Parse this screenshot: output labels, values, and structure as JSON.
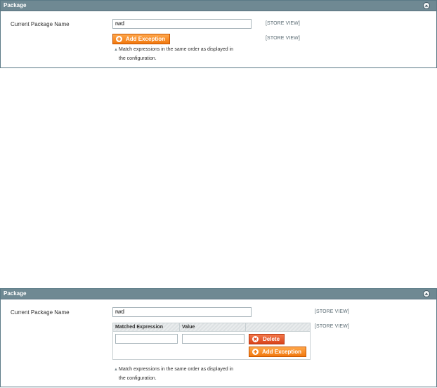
{
  "panels": [
    {
      "title": "Package",
      "field_label": "Current Package Name",
      "field_value": "rwd",
      "scope_field": "[STORE VIEW]",
      "scope_exceptions": "[STORE VIEW]",
      "add_exception_label": "Add Exception",
      "note_line1": "Match expressions in the same order as displayed in",
      "note_line2": "the configuration."
    },
    {
      "title": "Package",
      "field_label": "Current Package Name",
      "field_value": "rwd",
      "scope_field": "[STORE VIEW]",
      "scope_exceptions": "[STORE VIEW]",
      "grid_columns": [
        "Matched Expression",
        "Value"
      ],
      "row_expression": "",
      "row_value": "",
      "delete_label": "Delete",
      "add_exception_label": "Add Exception",
      "note_line1": "Match expressions in the same order as displayed in",
      "note_line2": "the configuration."
    }
  ],
  "icons": {
    "collapse": "chevron-up-icon",
    "add": "plus-circle-icon",
    "delete": "x-circle-icon",
    "note": "triangle-up-icon"
  },
  "colors": {
    "header_bg": "#6f8993",
    "orange_button": "#f1780e",
    "red_button": "#d9431a",
    "scope_text": "#5a6b73"
  }
}
